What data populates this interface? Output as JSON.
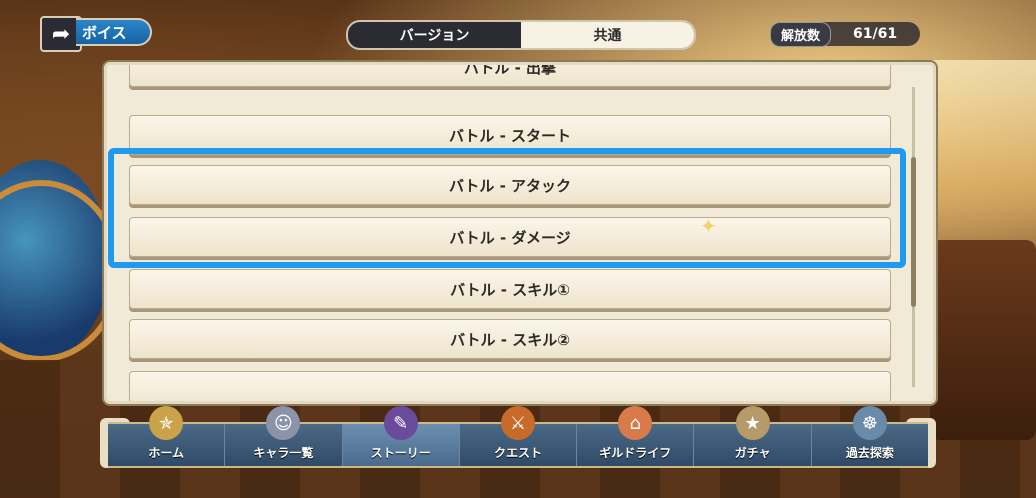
{
  "header": {
    "back_icon": "back-arrow-icon",
    "voice_tab_label": "ボイス"
  },
  "version_switch": {
    "options": [
      "バージョン",
      "共通"
    ],
    "selected": "共通"
  },
  "unlock": {
    "label": "解放数",
    "value": "61/61"
  },
  "voice_list": {
    "items": [
      "バトル - 出撃",
      "バトル - スタート",
      "バトル - アタック",
      "バトル - ダメージ",
      "バトル - スキル①",
      "バトル - スキル②",
      ""
    ],
    "highlighted": [
      "バトル - アタック",
      "バトル - ダメージ"
    ]
  },
  "nav": {
    "items": [
      {
        "label": "ホーム",
        "icon": "compass-icon"
      },
      {
        "label": "キャラ一覧",
        "icon": "characters-icon"
      },
      {
        "label": "ストーリー",
        "icon": "book-icon"
      },
      {
        "label": "クエスト",
        "icon": "quest-hero-icon"
      },
      {
        "label": "ギルドライフ",
        "icon": "guild-house-icon"
      },
      {
        "label": "ガチャ",
        "icon": "gacha-icon"
      },
      {
        "label": "過去探索",
        "icon": "ship-wheel-icon"
      }
    ],
    "active": "ストーリー"
  },
  "colors": {
    "highlight": "#1e9bf0",
    "voice_tab": "#1f77bb"
  }
}
